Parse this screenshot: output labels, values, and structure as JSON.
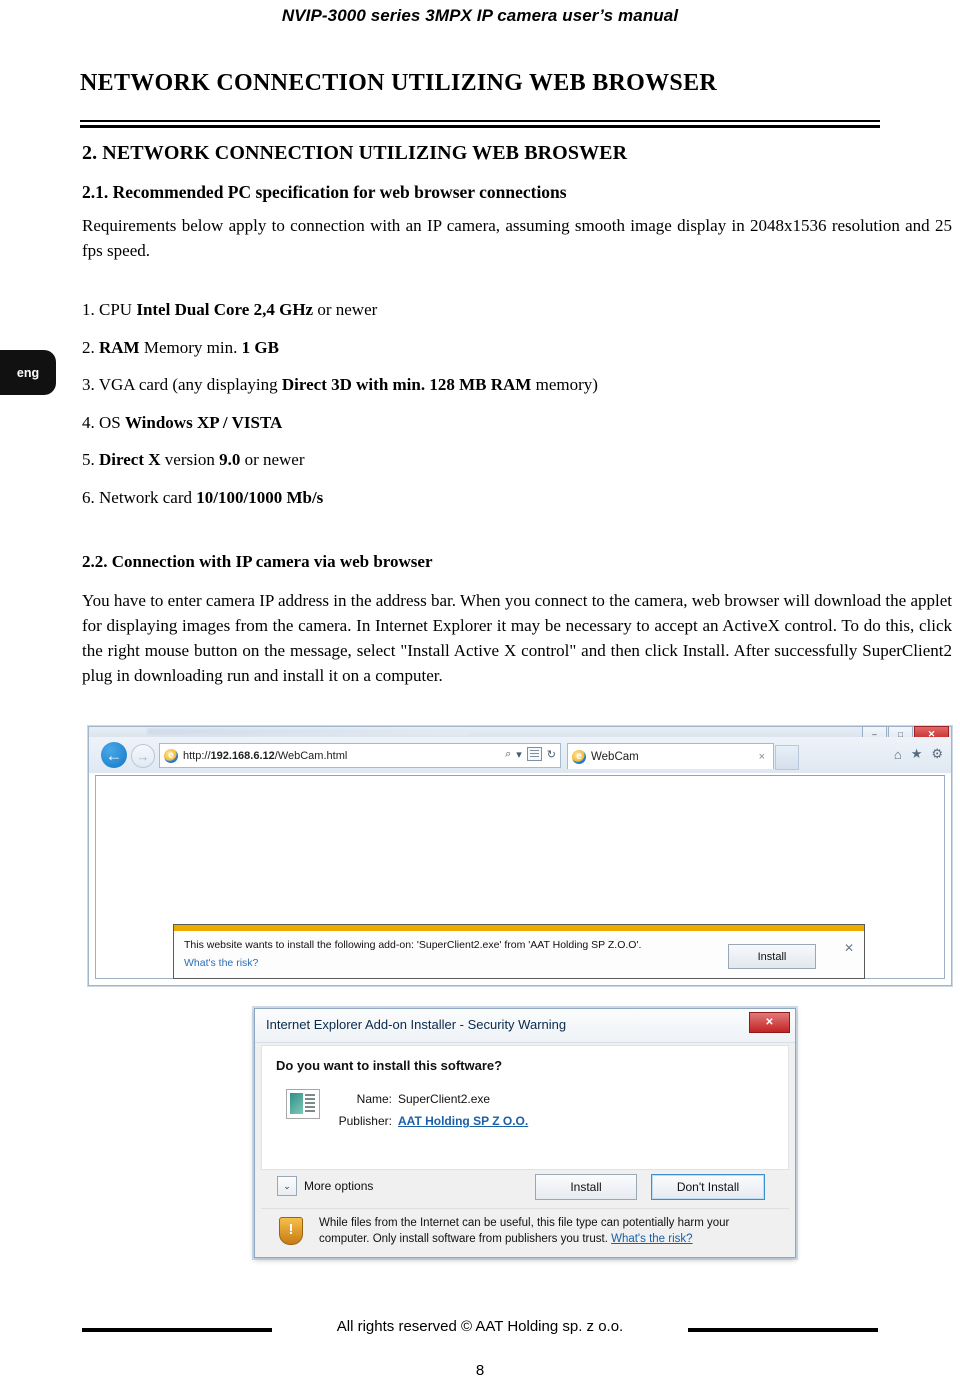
{
  "header": {
    "running_title": "NVIP-3000 series 3MPX IP camera user’s manual"
  },
  "chapter": {
    "title": "NETWORK CONNECTION UTILIZING WEB BROWSER"
  },
  "sections": {
    "h1": "2. NETWORK CONNECTION UTILIZING WEB BROSWER",
    "h2": "2.1. Recommended PC specification for web browser connections",
    "intro": "Requirements below apply to connection with an IP camera, assuming smooth image display in 2048x1536 resolution and 25 fps speed.",
    "h22": "2.2. Connection with IP camera via web browser",
    "para22": "You have to enter camera IP address in the address bar. When you connect to the camera, web browser will download the applet for displaying images from the camera. In Internet Explorer it may be necessary to accept an ActiveX control. To do this, click the right mouse button on the message, select \"Install Active X control\" and then click Install. After successfully SuperClient2 plug in downloading run and install it on a computer."
  },
  "spec_list": [
    {
      "num": "1.",
      "pre": "CPU ",
      "bold": "Intel Dual Core 2,4 GHz",
      "post": " or newer"
    },
    {
      "num": "2.",
      "pre": "",
      "bold": "RAM",
      "post": " Memory min. ",
      "bold2": "1 GB"
    },
    {
      "num": "3.",
      "pre": "VGA card (any displaying ",
      "bold": "Direct 3D with min. 128 MB RAM",
      "post": " memory)"
    },
    {
      "num": "4.",
      "pre": "OS ",
      "bold": "Windows XP / VISTA",
      "post": ""
    },
    {
      "num": "5.",
      "pre": "",
      "bold": "Direct X",
      "post": " version ",
      "bold2": "9.0",
      "post2": " or newer"
    },
    {
      "num": "6.",
      "pre": "Network card ",
      "bold": "10/100/1000 Mb/s",
      "post": ""
    }
  ],
  "lang_tab": {
    "label": "eng"
  },
  "browser": {
    "url_prefix": "http://",
    "url_host": "192.168.6.12",
    "url_path": "/WebCam.html",
    "url_full": "http://192.168.6.12/WebCam.html",
    "tab_title": "WebCam",
    "tab_close": "×",
    "back_glyph": "←",
    "forward_glyph": "→",
    "search_glyph": "⌕",
    "dropdown_glyph": "▾",
    "refresh_glyph": "↻",
    "home_glyph": "⌂",
    "star_glyph": "★",
    "gear_glyph": "⚙",
    "minimize_glyph": "–",
    "maximize_glyph": "□",
    "close_glyph": "✕"
  },
  "notification": {
    "message": "This website wants to install the following add-on: 'SuperClient2.exe' from 'AAT Holding SP Z.O.O'.",
    "risk_link": "What's the risk?",
    "install_label": "Install",
    "close_glyph": "✕"
  },
  "dialog": {
    "title": "Internet Explorer Add-on Installer - Security Warning",
    "close_glyph": "✕",
    "question": "Do you want to install this software?",
    "name_key": "Name:",
    "name_value": "SuperClient2.exe",
    "publisher_key": "Publisher:",
    "publisher_value": "AAT Holding SP Z O.O.",
    "more_options": "More options",
    "more_options_glyph": "⌄",
    "install_label": "Install",
    "dont_install_label": "Don't Install",
    "warning_text": "While files from the Internet can be useful, this file type can potentially harm your computer. Only install software from publishers you trust. ",
    "warning_link": "What's the risk?",
    "shield_glyph": "!"
  },
  "footer": {
    "copyright": "All rights reserved © AAT Holding sp. z o.o.",
    "page_number": "8"
  },
  "colors": {
    "notification_strip": "#edab00",
    "link_blue": "#1a5fa8",
    "close_red": "#c42323",
    "lang_tab_bg": "#111111"
  }
}
